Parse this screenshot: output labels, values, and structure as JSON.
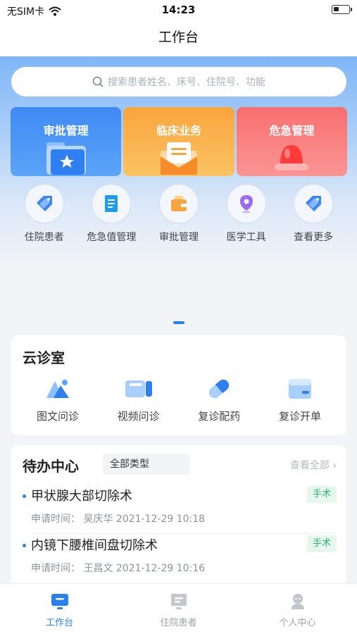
{
  "status_bar": {
    "carrier": "无SIM卡",
    "time": "14:23"
  },
  "nav": {
    "title": "工作台"
  },
  "search": {
    "placeholder": "搜索患者姓名、床号、住院号、功能"
  },
  "big_cards": [
    {
      "label": "审批管理",
      "icon": "folder-star-icon",
      "color": "#3f8af5"
    },
    {
      "label": "临床业务",
      "icon": "envelope-icon",
      "color": "#f9a53d"
    },
    {
      "label": "危急管理",
      "icon": "alarm-bell-icon",
      "color": "#f86f6f"
    }
  ],
  "shortcuts": [
    {
      "label": "住院患者",
      "icon": "tag-icon"
    },
    {
      "label": "危急值管理",
      "icon": "document-icon"
    },
    {
      "label": "审批管理",
      "icon": "wallet-icon"
    },
    {
      "label": "医学工具",
      "icon": "location-pin-icon"
    },
    {
      "label": "查看更多",
      "icon": "tag-icon"
    }
  ],
  "cloud_clinic": {
    "title": "云诊室",
    "items": [
      {
        "label": "图文问诊",
        "icon": "image-text-icon"
      },
      {
        "label": "视频问诊",
        "icon": "video-camera-icon"
      },
      {
        "label": "复诊配药",
        "icon": "pill-icon"
      },
      {
        "label": "复诊开单",
        "icon": "form-icon"
      }
    ]
  },
  "todo": {
    "title": "待办中心",
    "filter": "全部类型",
    "view_all": "查看全部",
    "items": [
      {
        "title": "甲状腺大部切除术",
        "tag": "手术",
        "meta": "申请时间：  吴庆华  2021-12-29 10:18"
      },
      {
        "title": "内镜下腰椎间盘切除术",
        "tag": "手术",
        "meta": "申请时间：  王昌文  2021-12-29 10:16"
      }
    ]
  },
  "tabbar": {
    "tabs": [
      {
        "label": "工作台",
        "icon": "monitor-icon",
        "active": true
      },
      {
        "label": "住院患者",
        "icon": "bed-screen-icon",
        "active": false
      },
      {
        "label": "个人中心",
        "icon": "person-icon",
        "active": false
      }
    ]
  },
  "colors": {
    "accent": "#2a7ff0",
    "tag_green": "#2bb47a"
  }
}
